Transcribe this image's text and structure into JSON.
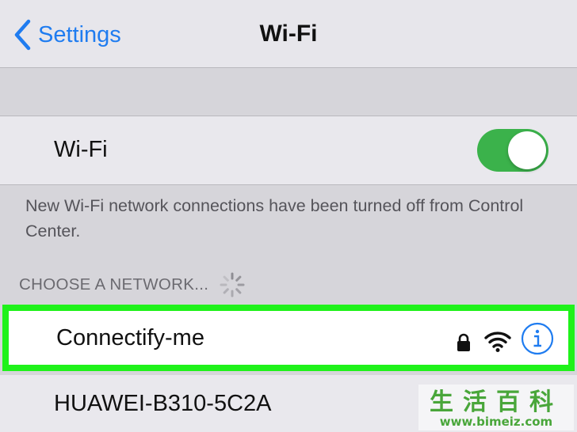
{
  "navbar": {
    "back_label": "Settings",
    "title": "Wi-Fi"
  },
  "wifi_toggle": {
    "label": "Wi-Fi",
    "state": "on",
    "on_color": "#3bb24b"
  },
  "info_message": "New Wi-Fi network connections have been turned off from Control Center.",
  "section": {
    "header": "CHOOSE A NETWORK..."
  },
  "networks": [
    {
      "name": "Connectify-me",
      "secured": true,
      "icons": [
        "lock-icon",
        "wifi-signal-icon",
        "info-icon"
      ],
      "highlight_color": "#1ff21a"
    },
    {
      "name": "HUAWEI-B310-5C2A"
    }
  ],
  "watermark": {
    "chars": "生活百科",
    "url": "www.bimeiz.com"
  },
  "colors": {
    "accent": "#1f7cf0",
    "background": "#d6d5da"
  }
}
